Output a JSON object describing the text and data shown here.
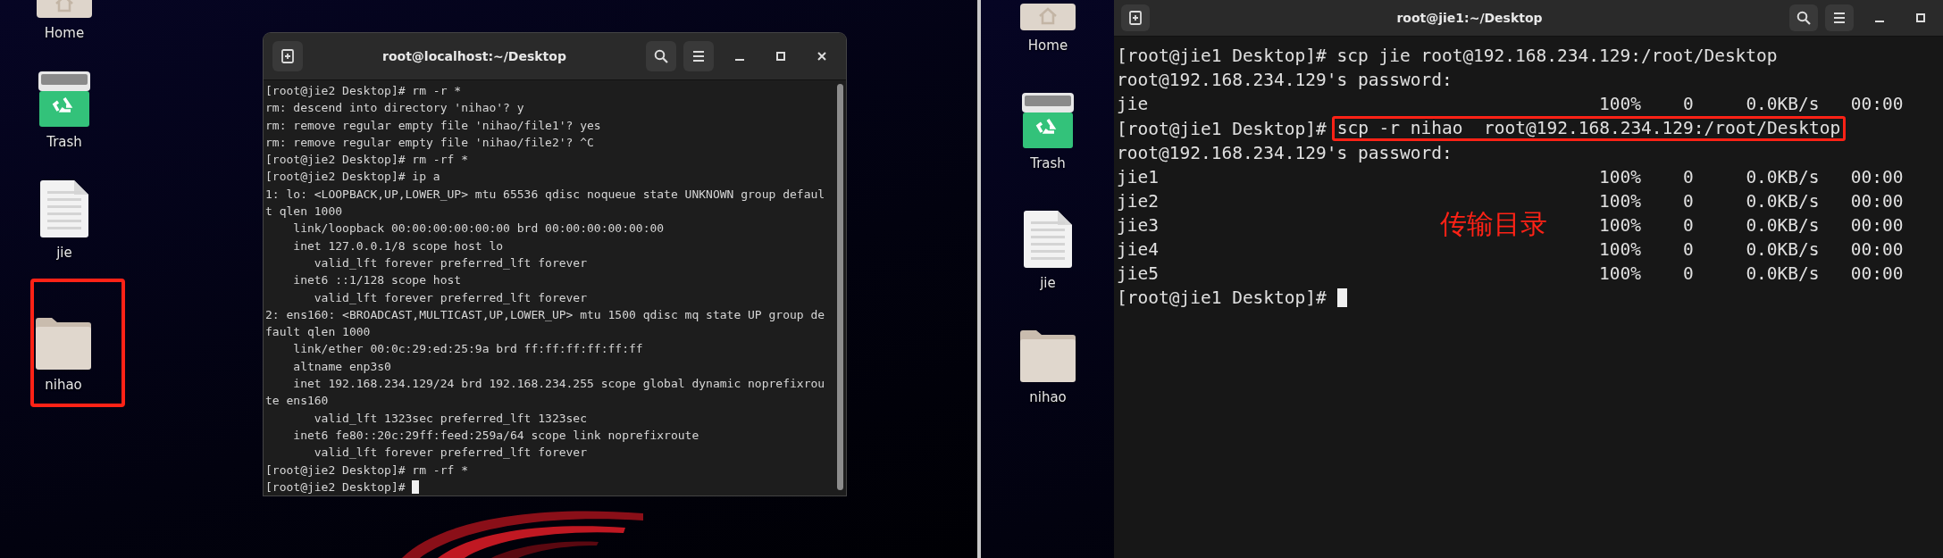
{
  "left": {
    "desktop_icons": [
      {
        "kind": "home",
        "label": "Home",
        "highlighted": false
      },
      {
        "kind": "trash",
        "label": "Trash",
        "highlighted": false
      },
      {
        "kind": "file",
        "label": "jie",
        "highlighted": false
      },
      {
        "kind": "folder",
        "label": "nihao",
        "highlighted": true
      }
    ],
    "terminal": {
      "title": "root@localhost:~/Desktop",
      "cursor": true,
      "lines": [
        {
          "kind": "command",
          "prompt": "[root@jie2 Desktop]#",
          "text": "rm -r *",
          "highlighted": false
        },
        {
          "kind": "output",
          "text": "rm: descend into directory 'nihao'? y"
        },
        {
          "kind": "output",
          "text": "rm: remove regular empty file 'nihao/file1'? yes"
        },
        {
          "kind": "output",
          "text": "rm: remove regular empty file 'nihao/file2'? ^C"
        },
        {
          "kind": "command",
          "prompt": "[root@jie2 Desktop]#",
          "text": "rm -rf *",
          "highlighted": false
        },
        {
          "kind": "command",
          "prompt": "[root@jie2 Desktop]#",
          "text": "ip a",
          "highlighted": false
        },
        {
          "kind": "output",
          "text": "1: lo: <LOOPBACK,UP,LOWER_UP> mtu 65536 qdisc noqueue state UNKNOWN group defaul"
        },
        {
          "kind": "output",
          "text": "t qlen 1000"
        },
        {
          "kind": "output",
          "text": "    link/loopback 00:00:00:00:00:00 brd 00:00:00:00:00:00"
        },
        {
          "kind": "output",
          "text": "    inet 127.0.0.1/8 scope host lo"
        },
        {
          "kind": "output",
          "text": "       valid_lft forever preferred_lft forever"
        },
        {
          "kind": "output",
          "text": "    inet6 ::1/128 scope host"
        },
        {
          "kind": "output",
          "text": "       valid_lft forever preferred_lft forever"
        },
        {
          "kind": "output",
          "text": "2: ens160: <BROADCAST,MULTICAST,UP,LOWER_UP> mtu 1500 qdisc mq state UP group de"
        },
        {
          "kind": "output",
          "text": "fault qlen 1000"
        },
        {
          "kind": "output",
          "text": "    link/ether 00:0c:29:ed:25:9a brd ff:ff:ff:ff:ff:ff"
        },
        {
          "kind": "output",
          "text": "    altname enp3s0"
        },
        {
          "kind": "output",
          "text": "    inet 192.168.234.129/24 brd 192.168.234.255 scope global dynamic noprefixrou"
        },
        {
          "kind": "output",
          "text": "te ens160"
        },
        {
          "kind": "output",
          "text": "       valid_lft 1323sec preferred_lft 1323sec"
        },
        {
          "kind": "output",
          "text": "    inet6 fe80::20c:29ff:feed:259a/64 scope link noprefixroute"
        },
        {
          "kind": "output",
          "text": "       valid_lft forever preferred_lft forever"
        },
        {
          "kind": "command",
          "prompt": "[root@jie2 Desktop]#",
          "text": "rm -rf *",
          "highlighted": false
        },
        {
          "kind": "command",
          "prompt": "[root@jie2 Desktop]#"
        }
      ]
    }
  },
  "right": {
    "desktop_icons": [
      {
        "kind": "home",
        "label": "Home",
        "highlighted": false
      },
      {
        "kind": "trash",
        "label": "Trash",
        "highlighted": false
      },
      {
        "kind": "file",
        "label": "jie",
        "highlighted": false
      },
      {
        "kind": "folder",
        "label": "nihao",
        "highlighted": false
      }
    ],
    "terminal": {
      "title": "root@jie1:~/Desktop",
      "cursor": true,
      "annotation": "传输目录",
      "lines": [
        {
          "kind": "command",
          "prompt": "[root@jie1 Desktop]#",
          "text": "scp jie root@192.168.234.129:/root/Desktop",
          "highlighted": false
        },
        {
          "kind": "output",
          "text": "root@192.168.234.129's password:"
        },
        {
          "kind": "transfer",
          "file": "jie",
          "percent": "100%",
          "size": "0",
          "rate": "0.0KB/s",
          "time": "00:00"
        },
        {
          "kind": "command",
          "prompt": "[root@jie1 Desktop]#",
          "text": "scp -r nihao  root@192.168.234.129:/root/Desktop",
          "highlighted": true
        },
        {
          "kind": "output",
          "text": "root@192.168.234.129's password:"
        },
        {
          "kind": "transfer",
          "file": "jie1",
          "percent": "100%",
          "size": "0",
          "rate": "0.0KB/s",
          "time": "00:00"
        },
        {
          "kind": "transfer",
          "file": "jie2",
          "percent": "100%",
          "size": "0",
          "rate": "0.0KB/s",
          "time": "00:00"
        },
        {
          "kind": "transfer",
          "file": "jie3",
          "percent": "100%",
          "size": "0",
          "rate": "0.0KB/s",
          "time": "00:00"
        },
        {
          "kind": "transfer",
          "file": "jie4",
          "percent": "100%",
          "size": "0",
          "rate": "0.0KB/s",
          "time": "00:00"
        },
        {
          "kind": "transfer",
          "file": "jie5",
          "percent": "100%",
          "size": "0",
          "rate": "0.0KB/s",
          "time": "00:00"
        },
        {
          "kind": "command",
          "prompt": "[root@jie1 Desktop]#"
        }
      ]
    }
  }
}
